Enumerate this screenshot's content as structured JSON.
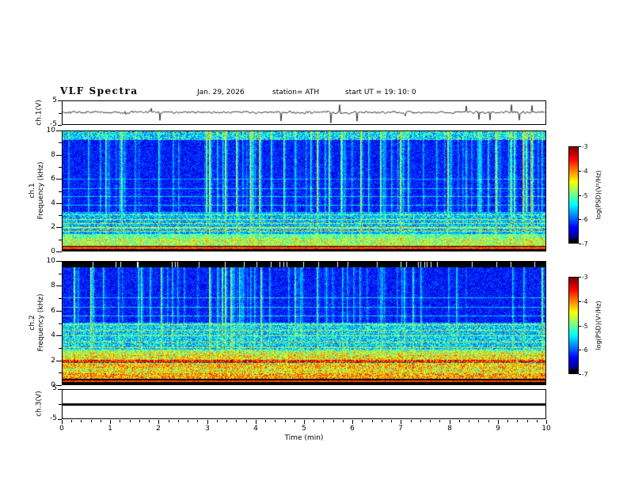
{
  "header": {
    "title": "VLF  Spectra",
    "date": "Jan. 29, 2026",
    "station": "station= ATH",
    "start_ut": "start UT  =  19: 10: 0"
  },
  "x_axis": {
    "label": "Time  (min)",
    "min": 0,
    "max": 10,
    "ticks": [
      0,
      1,
      2,
      3,
      4,
      5,
      6,
      7,
      8,
      9,
      10
    ]
  },
  "panels": {
    "wave1": {
      "channel_label": "ch.1(V)",
      "y_top": "5",
      "y_bottom": "-5"
    },
    "spec1": {
      "channel_label": "ch.1",
      "axis_label": "Frequency  (kHz)",
      "ymin": 0,
      "ymax": 10,
      "yticks": [
        0,
        2,
        4,
        6,
        8,
        10
      ]
    },
    "spec2": {
      "channel_label": "ch.2",
      "axis_label": "Frequency  (kHz)",
      "ymin": 0,
      "ymax": 10,
      "yticks": [
        0,
        2,
        4,
        6,
        8,
        10
      ]
    },
    "wave3": {
      "channel_label": "ch.3(V)",
      "y_top": "5",
      "y_bottom": "-5"
    }
  },
  "colorbars": [
    {
      "label": "log(PSD)(V²/Hz)",
      "ticks": [
        "-3",
        "-4",
        "-5",
        "-6",
        "-7"
      ],
      "vmin": -7,
      "vmax": -3
    },
    {
      "label": "log(PSD)(V²/Hz)",
      "ticks": [
        "-3",
        "-4",
        "-5",
        "-6",
        "-7"
      ],
      "vmin": -7,
      "vmax": -3
    }
  ],
  "chart_data": {
    "type": "composite",
    "title": "VLF Spectra",
    "date": "Jan. 29, 2026",
    "station": "ATH",
    "start_ut": "19:10:0",
    "x": {
      "label": "Time (min)",
      "range": [
        0,
        10
      ],
      "ticks": [
        0,
        1,
        2,
        3,
        4,
        5,
        6,
        7,
        8,
        9,
        10
      ]
    },
    "panels": [
      {
        "name": "ch1_waveform",
        "type": "line",
        "ylabel": "ch.1(V)",
        "ylim": [
          -5,
          5
        ],
        "summary": "broadband noisy signal fluctuating around 0 V (about ±1 V) with frequent impulsive spikes reaching toward ±5 V across the whole 10 min record"
      },
      {
        "name": "ch1_spectrogram",
        "type": "heatmap",
        "ylabel": "ch.1 Frequency (kHz)",
        "ylim": [
          0,
          10
        ],
        "zlabel": "log(PSD)(V²/Hz)",
        "zlim": [
          -7,
          -3
        ],
        "colormap": "rainbow/jet",
        "summary": "low PSD (dark blue, ~-7 to -6) above ~3 kHz crossed by dense vertical sferic streaks (green, ~-5); enhanced green/yellow horizontal bands (~-5 to -4) below ~3 kHz; bright narrow line near 0.2 kHz; black (no data) band at 0 kHz; speckled green enhancement near 9.5-10 kHz"
      },
      {
        "name": "ch2_spectrogram",
        "type": "heatmap",
        "ylabel": "ch.2 Frequency (kHz)",
        "ylim": [
          0,
          10
        ],
        "zlabel": "log(PSD)(V²/Hz)",
        "zlim": [
          -7,
          -3
        ],
        "colormap": "rainbow/jet",
        "summary": "similar vertical sferic streaks above ~5 kHz on dark blue background; strong green/yellow banded PSD (~-5 to -4) below ~5 kHz with several intense narrow lines between 1 and 3 kHz; black filtered band at top (~9.7-10 kHz) with occasional white gaps and black band at 0 kHz"
      },
      {
        "name": "ch3_waveform",
        "type": "line",
        "ylabel": "ch.3(V)",
        "ylim": [
          -5,
          5
        ],
        "summary": "completely flat thick line at 0 V (channel off / no signal)"
      }
    ]
  }
}
